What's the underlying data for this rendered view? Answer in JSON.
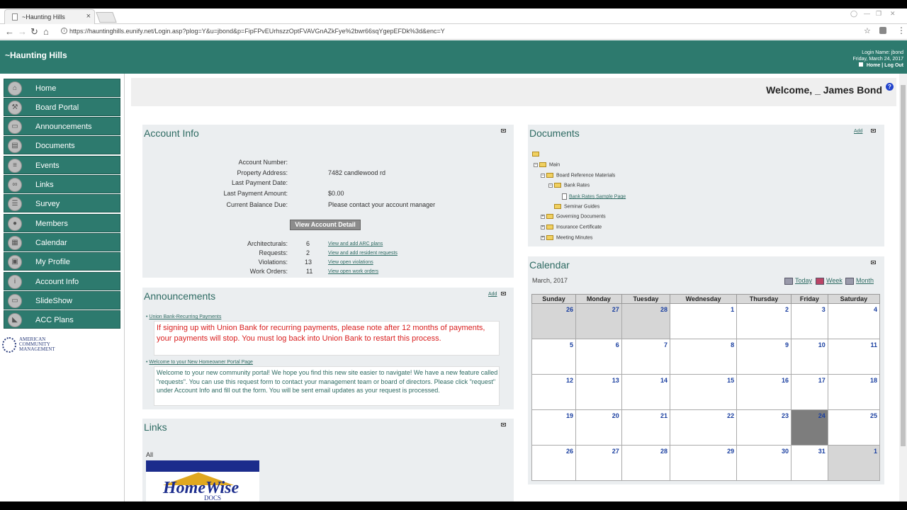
{
  "browser": {
    "tab_title": "~Haunting Hills",
    "url": "https://hauntinghills.eunify.net/Login.asp?plog=Y&u=jbond&p=FipFPvEUrhszzOptFVAVGnAZkFye%2bwr66sqYgepEFDk%3d&enc=Y"
  },
  "header": {
    "site_title": "~Haunting Hills",
    "login_name": "Login Name: jbond",
    "date": "Friday, March 24, 2017",
    "home_link": "Home |",
    "logout_link": "Log Out"
  },
  "sidebar": {
    "items": [
      {
        "label": "Home",
        "icon": "home-icon",
        "glyph": "⌂"
      },
      {
        "label": "Board Portal",
        "icon": "board-icon",
        "glyph": "⚒"
      },
      {
        "label": "Announcements",
        "icon": "announcements-icon",
        "glyph": "▭"
      },
      {
        "label": "Documents",
        "icon": "documents-icon",
        "glyph": "▤"
      },
      {
        "label": "Events",
        "icon": "events-icon",
        "glyph": "≡"
      },
      {
        "label": "Links",
        "icon": "links-icon",
        "glyph": "∞"
      },
      {
        "label": "Survey",
        "icon": "survey-icon",
        "glyph": "☰"
      },
      {
        "label": "Members",
        "icon": "members-icon",
        "glyph": "●"
      },
      {
        "label": "Calendar",
        "icon": "calendar-icon",
        "glyph": "▦"
      },
      {
        "label": "My Profile",
        "icon": "profile-icon",
        "glyph": "▣"
      },
      {
        "label": "Account Info",
        "icon": "info-icon",
        "glyph": "i"
      },
      {
        "label": "SlideShow",
        "icon": "slideshow-icon",
        "glyph": "▭"
      },
      {
        "label": "ACC Plans",
        "icon": "plans-icon",
        "glyph": "◣"
      }
    ],
    "logo_lines": [
      "AMERICAN",
      "COMMUNITY",
      "MANAGEMENT"
    ]
  },
  "welcome": "Welcome, _ James Bond",
  "account": {
    "title": "Account Info",
    "fields": [
      {
        "label": "Account Number:",
        "value": ""
      },
      {
        "label": "Property Address:",
        "value": "7482 candlewood rd"
      },
      {
        "label": "Last Payment Date:",
        "value": ""
      },
      {
        "label": "Last Payment Amount:",
        "value": "$0.00"
      },
      {
        "label": "Current Balance Due:",
        "value": "Please contact your account manager"
      }
    ],
    "detail_button": "View Account Detail",
    "stats": [
      {
        "label": "Architecturals:",
        "count": "6",
        "link": "View and add ARC plans"
      },
      {
        "label": "Requests:",
        "count": "2",
        "link": "View and add resident requests"
      },
      {
        "label": "Violations:",
        "count": "13",
        "link": "View open violations"
      },
      {
        "label": "Work Orders:",
        "count": "11",
        "link": "View open work orders"
      }
    ]
  },
  "announcements": {
    "title": "Announcements",
    "add": "Add",
    "items": [
      {
        "title": "Union Bank-Recurring Payments",
        "body": "If signing up with Union Bank for recurring payments, please note after 12 months of payments, your payments will stop. You must log back into Union Bank to restart this process."
      },
      {
        "title": "Welcome to your New Homeowner Portal Page",
        "body": "Welcome to your new community portal! We hope you find this new site easier to navigate! We have a new feature called \"requests\". You can use this request form to contact your management team or board of directors. Please click \"request\" under Account Info and fill out the form. You will be sent email updates as your request is processed."
      }
    ]
  },
  "links": {
    "title": "Links",
    "filter": "All",
    "logo_text": "HomeWise",
    "logo_sub": "DOCS"
  },
  "documents": {
    "title": "Documents",
    "add": "Add",
    "tree": [
      {
        "label": "Main",
        "expander": "−"
      },
      {
        "label": "Board Reference Materials",
        "expander": "−"
      },
      {
        "label": "Bank Rates",
        "expander": "−"
      },
      {
        "label": "Bank Rates Sample Page",
        "expander": ""
      },
      {
        "label": "Seminar Guides",
        "expander": ""
      },
      {
        "label": "Governing Documents",
        "expander": "+"
      },
      {
        "label": "Insurance Certificate",
        "expander": "+"
      },
      {
        "label": "Meeting Minutes",
        "expander": "+"
      }
    ]
  },
  "calendar": {
    "title": "Calendar",
    "month": "March, 2017",
    "views": [
      "Today",
      "Week",
      "Month"
    ],
    "days": [
      "Sunday",
      "Monday",
      "Tuesday",
      "Wednesday",
      "Thursday",
      "Friday",
      "Saturday"
    ],
    "weeks": [
      [
        "26",
        "27",
        "28",
        "1",
        "2",
        "3",
        "4"
      ],
      [
        "5",
        "6",
        "7",
        "8",
        "9",
        "10",
        "11"
      ],
      [
        "12",
        "13",
        "14",
        "15",
        "16",
        "17",
        "18"
      ],
      [
        "19",
        "20",
        "21",
        "22",
        "23",
        "24",
        "25"
      ],
      [
        "26",
        "27",
        "28",
        "29",
        "30",
        "31",
        "1"
      ]
    ],
    "today": "24"
  }
}
